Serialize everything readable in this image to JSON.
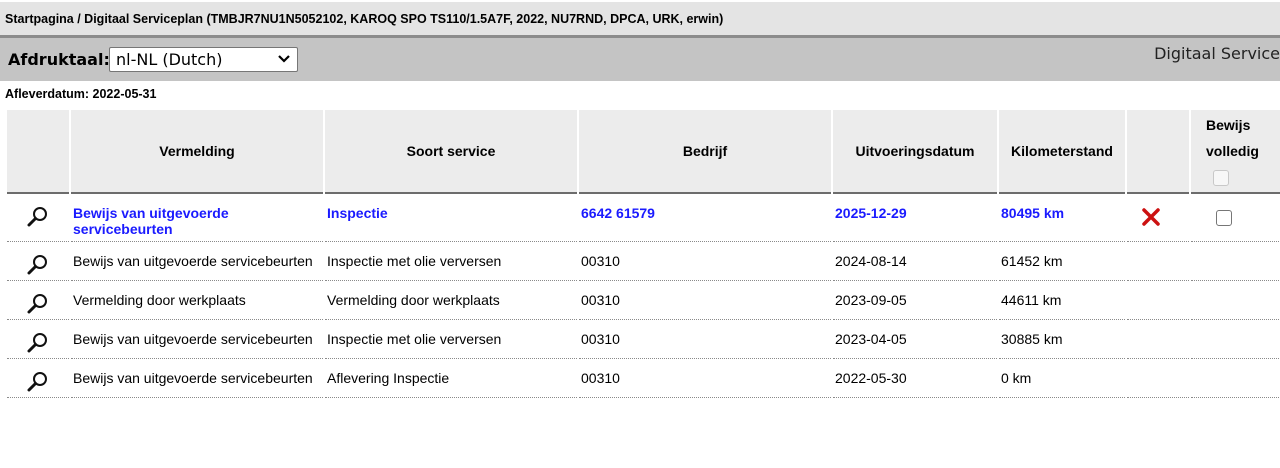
{
  "breadcrumb": "Startpagina / Digitaal Serviceplan (TMBJR7NU1N5052102, KAROQ SPO TS110/1.5A7F, 2022, NU7RND, DPCA, URK, erwin)",
  "toolbar": {
    "language_label": "Afdruktaal:",
    "language_value": "nl-NL (Dutch)",
    "title": "Digitaal Service"
  },
  "delivery_date": "Afleverdatum: 2022-05-31",
  "columns": {
    "vermelding": "Vermelding",
    "soort": "Soort service",
    "bedrijf": "Bedrijf",
    "datum": "Uitvoeringsdatum",
    "km": "Kilometerstand",
    "bewijs_line1": "Bewijs",
    "bewijs_line2": "volledig"
  },
  "rows": [
    {
      "vermelding": "Bewijs van uitgevoerde servicebeurten",
      "soort": "Inspectie",
      "bedrijf": "6642 61579",
      "datum": "2025-12-29",
      "km": "80495 km",
      "highlighted": true
    },
    {
      "vermelding": "Bewijs van uitgevoerde servicebeurten",
      "soort": "Inspectie met olie verversen",
      "bedrijf": "00310",
      "datum": "2024-08-14",
      "km": "61452 km"
    },
    {
      "vermelding": "Vermelding door werkplaats",
      "soort": "Vermelding door werkplaats",
      "bedrijf": "00310",
      "datum": "2023-09-05",
      "km": "44611 km"
    },
    {
      "vermelding": "Bewijs van uitgevoerde servicebeurten",
      "soort": "Inspectie met olie verversen",
      "bedrijf": "00310",
      "datum": "2023-04-05",
      "km": "30885 km"
    },
    {
      "vermelding": "Bewijs van uitgevoerde servicebeurten",
      "soort": "Aflevering Inspectie",
      "bedrijf": "00310",
      "datum": "2022-05-30",
      "km": "0 km"
    }
  ],
  "colors": {
    "highlight_text": "#1a1aff",
    "delete_icon": "#cc1111"
  },
  "icons": {
    "details": "magnifier-icon",
    "delete": "delete-x-icon",
    "dropdown": "chevron-down-icon"
  }
}
